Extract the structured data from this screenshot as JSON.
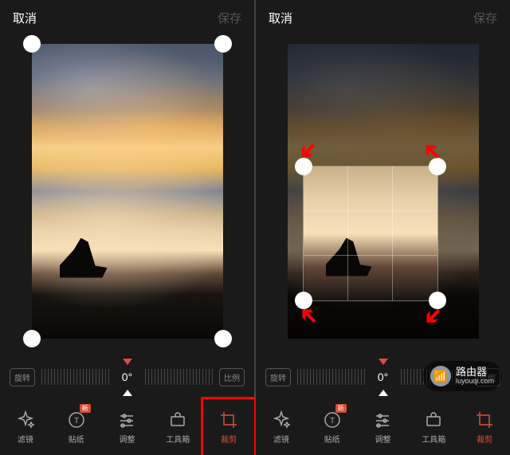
{
  "topbar": {
    "cancel": "取消",
    "save": "保存"
  },
  "slider": {
    "rotate": "旋转",
    "degree": "0°",
    "ratio": "比例"
  },
  "tools": {
    "filter": "滤镜",
    "sticker": "贴纸",
    "sticker_badge": "新",
    "adjust": "调整",
    "toolbox": "工具箱",
    "crop": "裁剪"
  },
  "watermark": {
    "title": "路由器",
    "url": "luyouqi.com"
  }
}
